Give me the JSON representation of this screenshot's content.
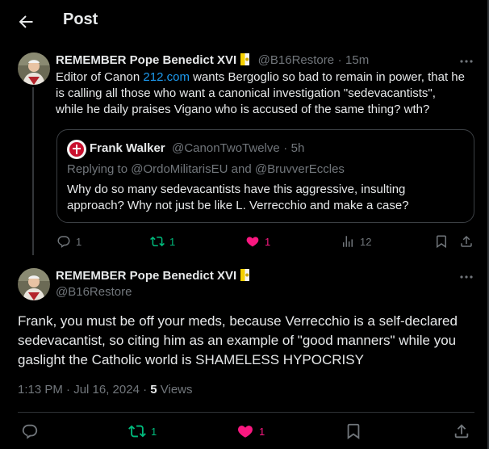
{
  "header": {
    "title": "Post"
  },
  "reply_parent": {
    "name": "REMEMBER Pope Benedict XVI",
    "handle": "@B16Restore",
    "sep": "·",
    "time": "15m",
    "text_pre": "Editor of Canon ",
    "text_link": "212.com",
    "text_line1_post": " wants Bergoglio so bad to remain in power, that he",
    "text_line2": "is calling all those who want a canonical investigation \"sedevacantists\",",
    "text_line3": "while he daily praises Vigano who is accused of the same thing? wth?",
    "quote": {
      "name": "Frank Walker",
      "handle": "@CanonTwoTwelve",
      "sep": "·",
      "time": "5h",
      "replying_prefix": "Replying to ",
      "replying_to_1": "@OrdoMilitarisEU",
      "replying_and": " and ",
      "replying_to_2": "@BruvverEccles",
      "text_line1": "Why do so many sedevacantists have this aggressive, insulting",
      "text_line2": "approach? Why not just be like L. Verrecchio and make a case?"
    },
    "actions": {
      "replies": "1",
      "reposts": "1",
      "likes": "1",
      "views": "12"
    }
  },
  "main_post": {
    "name": "REMEMBER Pope Benedict XVI",
    "handle": "@B16Restore",
    "text_line1": "Frank, you must be off your meds, because Verrecchio is a self-declared",
    "text_line2": "sedevacantist, so citing him as an example of \"good manners\" while you",
    "text_line3": "gaslight the Catholic world is SHAMELESS HYPOCRISY",
    "meta_time": "1:13 PM · Jul 16, 2024 · ",
    "meta_views_count": "5",
    "meta_views_label": " Views",
    "actions": {
      "reposts": "1",
      "likes": "1"
    }
  },
  "colors": {
    "background": "#000000",
    "accent": "#1d9bf0",
    "repost": "#00ba7c",
    "like": "#f91880",
    "muted": "#71767b"
  }
}
